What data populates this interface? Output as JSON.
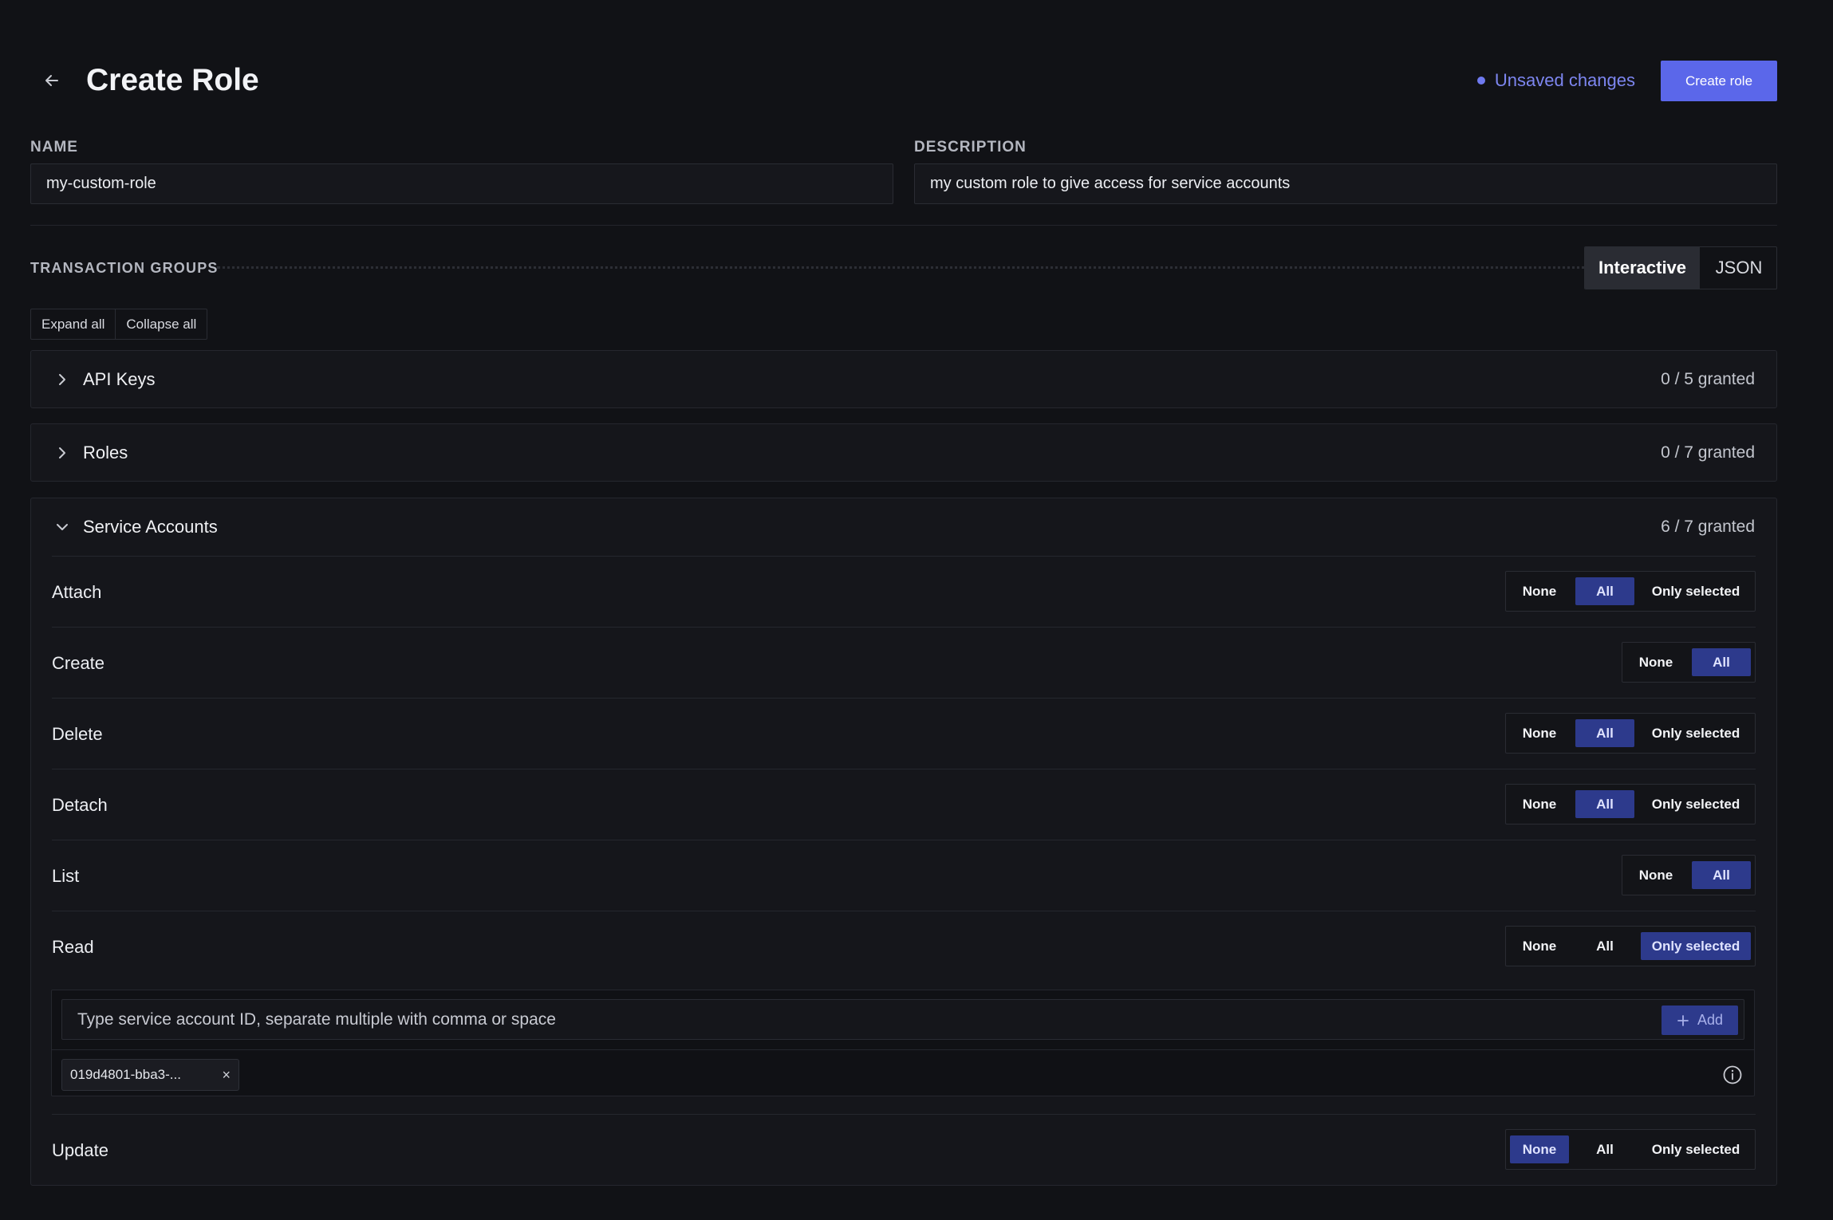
{
  "header": {
    "title": "Create Role",
    "unsaved": "Unsaved changes",
    "create_button": "Create role"
  },
  "form": {
    "name_label": "NAME",
    "name_value": "my-custom-role",
    "description_label": "DESCRIPTION",
    "description_value": "my custom role to give access for service accounts"
  },
  "transaction_groups": {
    "label": "TRANSACTION GROUPS",
    "view_options": [
      "Interactive",
      "JSON"
    ],
    "active_view": "Interactive",
    "expand_all": "Expand all",
    "collapse_all": "Collapse all"
  },
  "groups": [
    {
      "name": "API Keys",
      "count": "0 / 5 granted",
      "expanded": false
    },
    {
      "name": "Roles",
      "count": "0 / 7 granted",
      "expanded": false
    },
    {
      "name": "Service Accounts",
      "count": "6 / 7 granted",
      "expanded": true
    }
  ],
  "options": {
    "none": "None",
    "all": "All",
    "only_selected": "Only selected"
  },
  "permissions": [
    {
      "name": "Attach",
      "selected": "All"
    },
    {
      "name": "Create",
      "selected": "All"
    },
    {
      "name": "Delete",
      "selected": "All"
    },
    {
      "name": "Detach",
      "selected": "All"
    },
    {
      "name": "List",
      "selected": "All"
    },
    {
      "name": "Read",
      "selected": "Only selected"
    },
    {
      "name": "Update",
      "selected": "None"
    }
  ],
  "read_selection": {
    "placeholder": "Type service account ID, separate multiple with comma or space",
    "add_label": "Add",
    "chips": [
      "019d4801-bba3-..."
    ]
  },
  "colors": {
    "accent": "#5b67ea",
    "segment_active": "#2d3a8c",
    "background": "#111216"
  }
}
